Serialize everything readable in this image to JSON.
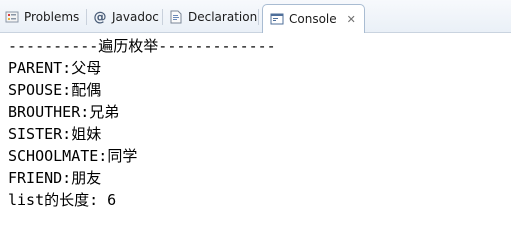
{
  "tabs": [
    {
      "label": "Problems",
      "icon": "problems-icon"
    },
    {
      "label": "Javadoc",
      "icon": "at-icon"
    },
    {
      "label": "Declaration",
      "icon": "declaration-icon"
    },
    {
      "label": "Console",
      "icon": "console-icon",
      "active": true,
      "close": "✕"
    }
  ],
  "console": {
    "lines": [
      "----------遍历枚举-------------",
      "PARENT:父母",
      "SPOUSE:配偶",
      "BROUTHER:兄弟",
      "SISTER:姐妹",
      "SCHOOLMATE:同学",
      "FRIEND:朋友",
      "list的长度: 6"
    ]
  },
  "colors": {
    "tabbar_bg": "#eaf0f7",
    "active_tab_border": "#a9bcd2",
    "console_bg": "#ffffff",
    "text": "#000000"
  }
}
